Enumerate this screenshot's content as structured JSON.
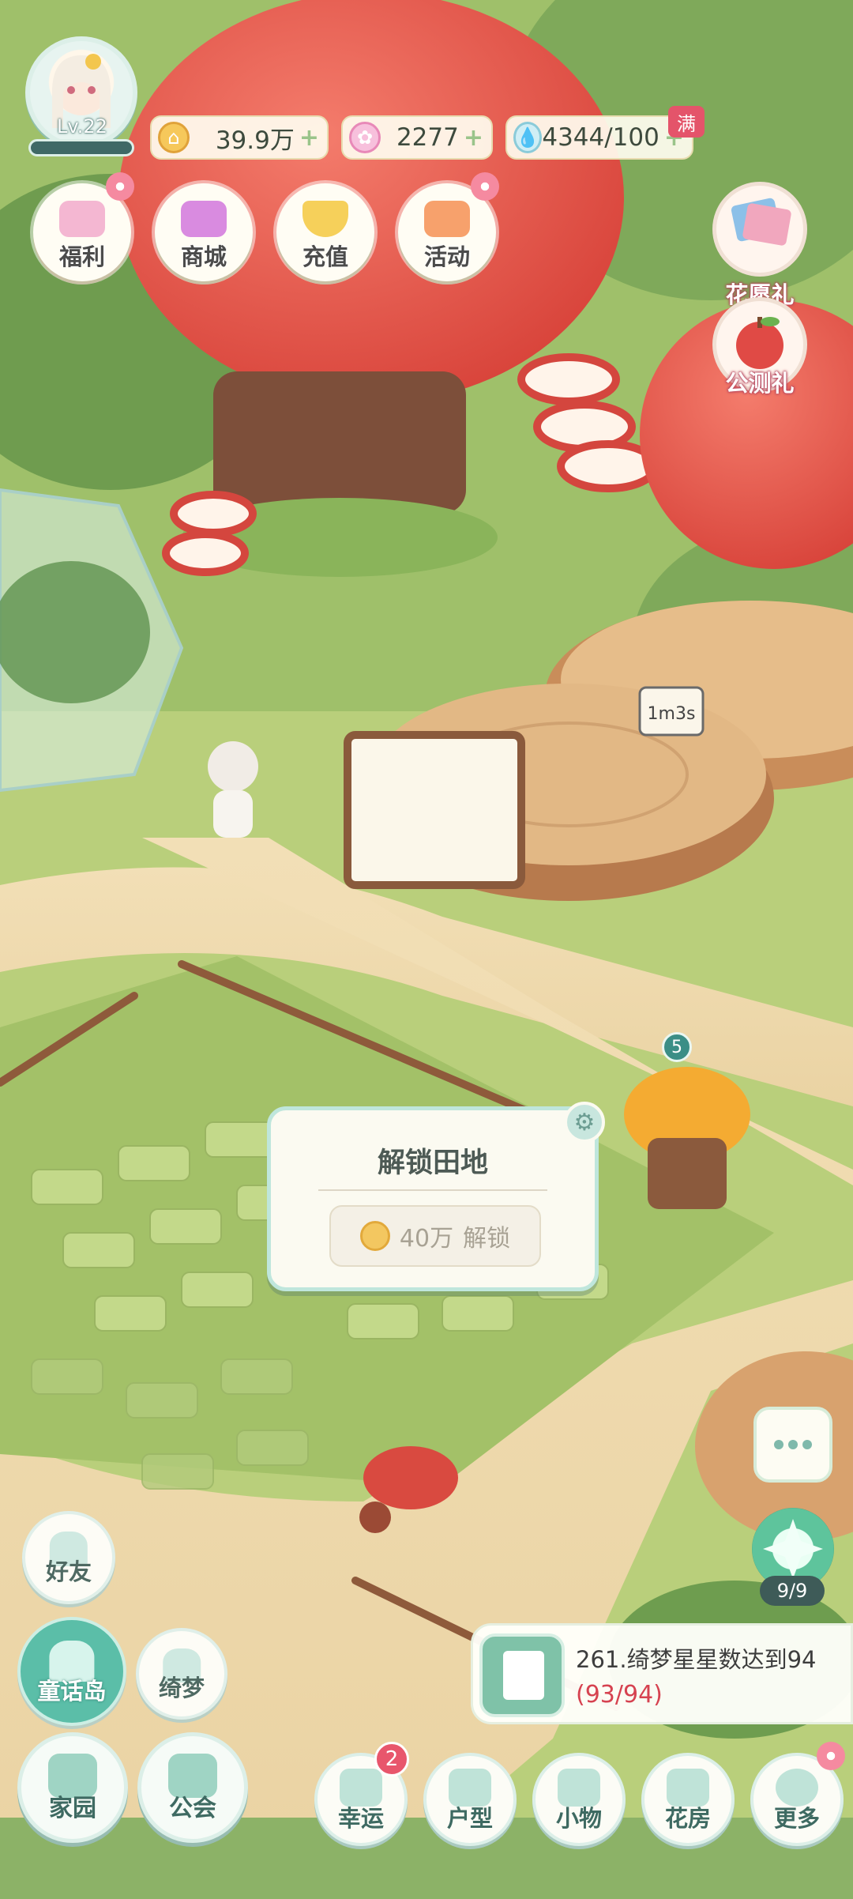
{
  "player": {
    "level": "Lv.22"
  },
  "resources": [
    {
      "icon": "coin-icon",
      "value": "39.9万"
    },
    {
      "icon": "star-gem-icon",
      "value": "2277"
    },
    {
      "icon": "water-drop-icon",
      "value": "4344/100"
    }
  ],
  "water_full_badge": "满",
  "top_buttons": [
    "福利",
    "商城",
    "充值",
    "活动"
  ],
  "right_gifts": [
    "花愿礼",
    "公测礼"
  ],
  "scene": {
    "timer_sign": "1m3s",
    "well_badge": "5"
  },
  "popup": {
    "title": "解锁田地",
    "cost": "40万",
    "action": "解锁"
  },
  "left_buttons": {
    "friends": "好友",
    "island": "童话岛",
    "dream": "绮梦"
  },
  "star_counter": "9/9",
  "task": {
    "text": "261.绮梦星星数达到94",
    "progress": "(93/94)"
  },
  "bottom_nav": {
    "home": "家园",
    "guild": "公会",
    "luck": "幸运",
    "luck_badge": "2",
    "layout": "户型",
    "items": "小物",
    "greenhouse": "花房",
    "more": "更多"
  },
  "colors": {
    "accent": "#5bbea8",
    "alert": "#e8566c",
    "progress_text": "#d64250"
  }
}
